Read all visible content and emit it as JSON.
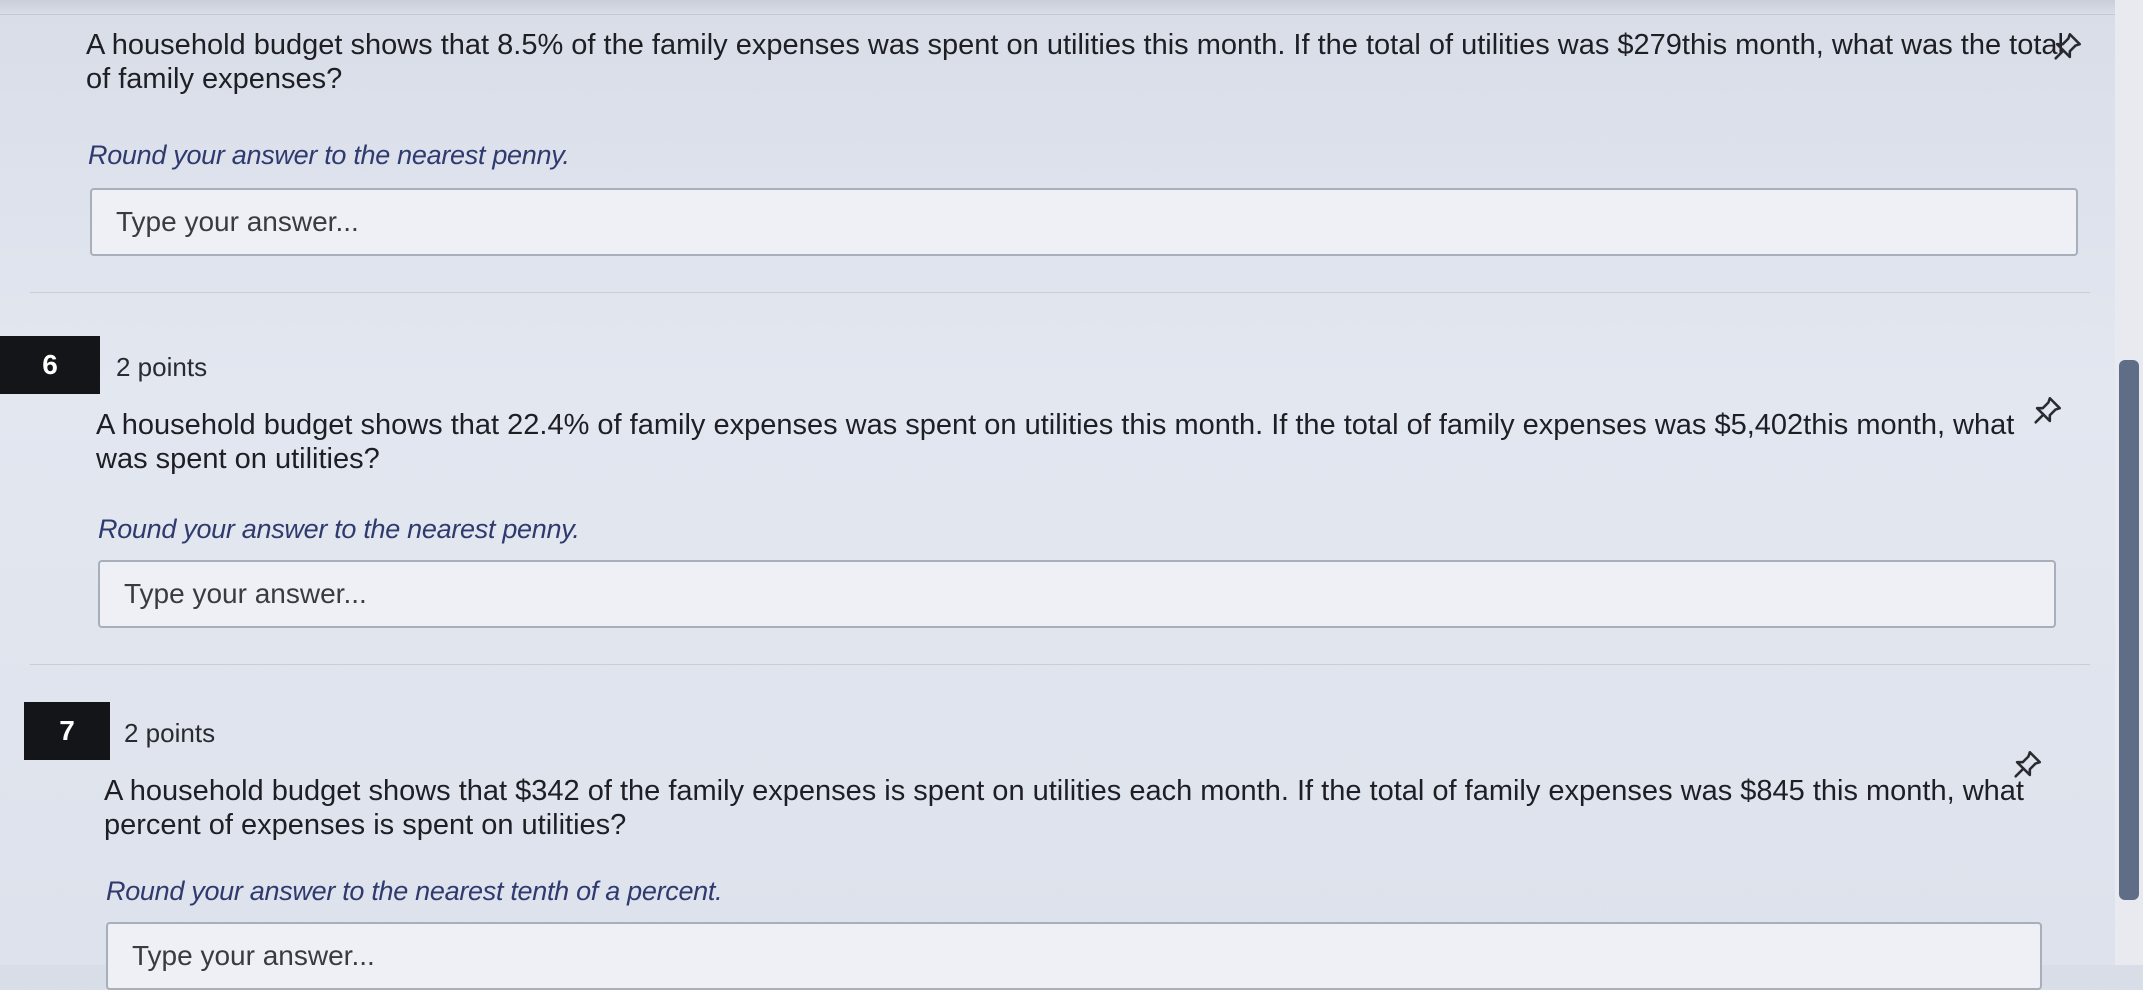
{
  "questions": [
    {
      "text": "A household budget shows that 8.5% of the family expenses was spent on utilities this month. If the total of utilities was $279this month, what was the total of family expenses?",
      "instruction": "Round your answer to the nearest penny.",
      "answer_placeholder": "Type your answer..."
    },
    {
      "number": "6",
      "points": "2 points",
      "text": "A household budget shows that 22.4% of family expenses was spent on utilities this month. If the total of family expenses was $5,402this month, what was spent on utilities?",
      "instruction": "Round your answer to the nearest penny.",
      "answer_placeholder": "Type your answer..."
    },
    {
      "number": "7",
      "points": "2 points",
      "text": "A household budget shows that $342 of the family expenses is spent on utilities each month. If the total of family expenses was $845 this month, what percent of expenses is spent on utilities?",
      "instruction": "Round your answer to the nearest tenth of a percent.",
      "answer_placeholder": "Type your answer..."
    }
  ],
  "icons": {
    "pin": "pin-icon"
  },
  "colors": {
    "instruction_text": "#2f3a6e",
    "number_badge": "#141518",
    "scrollbar_thumb": "#5f6d86"
  }
}
